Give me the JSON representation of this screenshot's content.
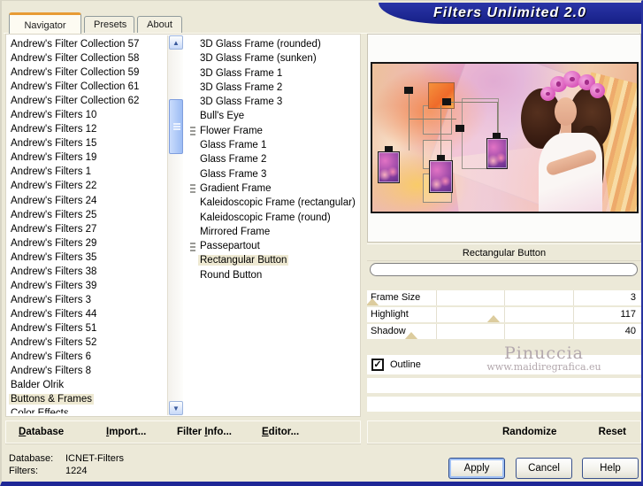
{
  "window": {
    "title": "Filters Unlimited 2.0"
  },
  "tabs": [
    {
      "label": "Navigator",
      "active": true
    },
    {
      "label": "Presets",
      "active": false
    },
    {
      "label": "About",
      "active": false
    }
  ],
  "left_list": {
    "selected": "Buttons & Frames",
    "items": [
      "Andrew's Filter Collection 57",
      "Andrew's Filter Collection 58",
      "Andrew's Filter Collection 59",
      "Andrew's Filter Collection 61",
      "Andrew's Filter Collection 62",
      "Andrew's Filters 10",
      "Andrew's Filters 12",
      "Andrew's Filters 15",
      "Andrew's Filters 19",
      "Andrew's Filters 1",
      "Andrew's Filters 22",
      "Andrew's Filters 24",
      "Andrew's Filters 25",
      "Andrew's Filters 27",
      "Andrew's Filters 29",
      "Andrew's Filters 35",
      "Andrew's Filters 38",
      "Andrew's Filters 39",
      "Andrew's Filters 3",
      "Andrew's Filters 44",
      "Andrew's Filters 51",
      "Andrew's Filters 52",
      "Andrew's Filters 6",
      "Andrew's Filters 8",
      "Balder Olrik",
      "Buttons & Frames",
      "Color Effects"
    ]
  },
  "filter_list": {
    "selected": "Rectangular Button",
    "items": [
      {
        "label": "3D Glass Frame (rounded)",
        "icon": false
      },
      {
        "label": "3D Glass Frame (sunken)",
        "icon": false
      },
      {
        "label": "3D Glass Frame 1",
        "icon": false
      },
      {
        "label": "3D Glass Frame 2",
        "icon": false
      },
      {
        "label": "3D Glass Frame 3",
        "icon": false
      },
      {
        "label": "Bull's Eye",
        "icon": false
      },
      {
        "label": "Flower Frame",
        "icon": true
      },
      {
        "label": "Glass Frame 1",
        "icon": false
      },
      {
        "label": "Glass Frame 2",
        "icon": false
      },
      {
        "label": "Glass Frame 3",
        "icon": false
      },
      {
        "label": "Gradient Frame",
        "icon": true
      },
      {
        "label": "Kaleidoscopic Frame (rectangular)",
        "icon": false
      },
      {
        "label": "Kaleidoscopic Frame (round)",
        "icon": false
      },
      {
        "label": "Mirrored Frame",
        "icon": false
      },
      {
        "label": "Passepartout",
        "icon": true
      },
      {
        "label": "Rectangular Button",
        "icon": false
      },
      {
        "label": "Round Button",
        "icon": false
      }
    ]
  },
  "control_panel": {
    "header": "Rectangular Button",
    "sliders": [
      {
        "label": "Frame Size",
        "value": "3",
        "marker_pct": 2
      },
      {
        "label": "Highlight",
        "value": "117",
        "marker_pct": 46
      },
      {
        "label": "Shadow",
        "value": "40",
        "marker_pct": 16
      }
    ],
    "checkbox": {
      "label": "Outline",
      "checked": true
    }
  },
  "preview": {
    "watermark_title": "Pinuccia",
    "watermark_url": "www.maidiregrafica.eu"
  },
  "toolbar": {
    "left": [
      {
        "pre": "",
        "u": "D",
        "rest": "atabase"
      },
      {
        "pre": "",
        "u": "I",
        "rest": "mport..."
      },
      {
        "pre": "Filter ",
        "u": "I",
        "rest": "nfo..."
      },
      {
        "pre": "",
        "u": "E",
        "rest": "ditor..."
      }
    ],
    "right": [
      "Randomize",
      "Reset"
    ]
  },
  "status": {
    "db_label": "Database:",
    "db_value": "ICNET-Filters",
    "filters_label": "Filters:",
    "filters_value": "1224"
  },
  "buttons": [
    "Apply",
    "Cancel",
    "Help"
  ],
  "icons": {
    "scroll_up": "▲",
    "scroll_down": "▼",
    "check": "✓"
  },
  "colors": {
    "title_bar": "#1e2796",
    "selection": "#eee9d2",
    "slider_marker": "#dccc9e",
    "tab_accent": "#e79b34"
  }
}
